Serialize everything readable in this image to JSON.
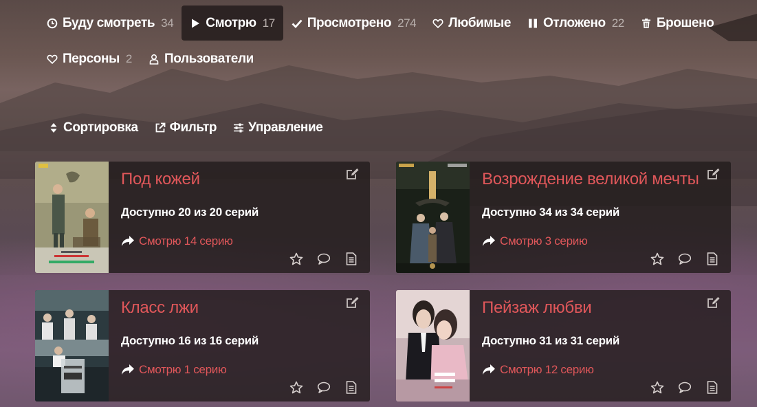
{
  "nav": {
    "row1": [
      {
        "id": "plan",
        "icon": "clock-icon",
        "label": "Буду смотреть",
        "count": "34",
        "active": false
      },
      {
        "id": "watching",
        "icon": "play-icon",
        "label": "Смотрю",
        "count": "17",
        "active": true
      },
      {
        "id": "completed",
        "icon": "check-icon",
        "label": "Просмотрено",
        "count": "274",
        "active": false
      },
      {
        "id": "favorites",
        "icon": "heart-icon",
        "label": "Любимые",
        "count": "",
        "active": false
      },
      {
        "id": "onhold",
        "icon": "pause-icon",
        "label": "Отложено",
        "count": "22",
        "active": false
      },
      {
        "id": "dropped",
        "icon": "trash-icon",
        "label": "Брошено",
        "count": "",
        "active": false
      }
    ],
    "row2": [
      {
        "id": "persons",
        "icon": "heart-icon",
        "label": "Персоны",
        "count": "2"
      },
      {
        "id": "users",
        "icon": "user-icon",
        "label": "Пользователи",
        "count": ""
      }
    ]
  },
  "tools": {
    "sort": "Сортировка",
    "filter": "Фильтр",
    "manage": "Управление"
  },
  "cards": [
    {
      "title": "Под кожей",
      "available": "Доступно 20 из 20 серий",
      "watching": "Смотрю 14 серию"
    },
    {
      "title": "Возрождение великой мечты",
      "available": "Доступно 34 из 34 серий",
      "watching": "Смотрю 3 серию"
    },
    {
      "title": "Класс лжи",
      "available": "Доступно 16 из 16 серий",
      "watching": "Смотрю 1 серию"
    },
    {
      "title": "Пейзаж любви",
      "available": "Доступно 31 из 31 серий",
      "watching": "Смотрю 12 серию"
    }
  ],
  "colors": {
    "accent": "#e0575a",
    "card_bg": "#221b1b",
    "count_text": "#b9b0ad"
  }
}
